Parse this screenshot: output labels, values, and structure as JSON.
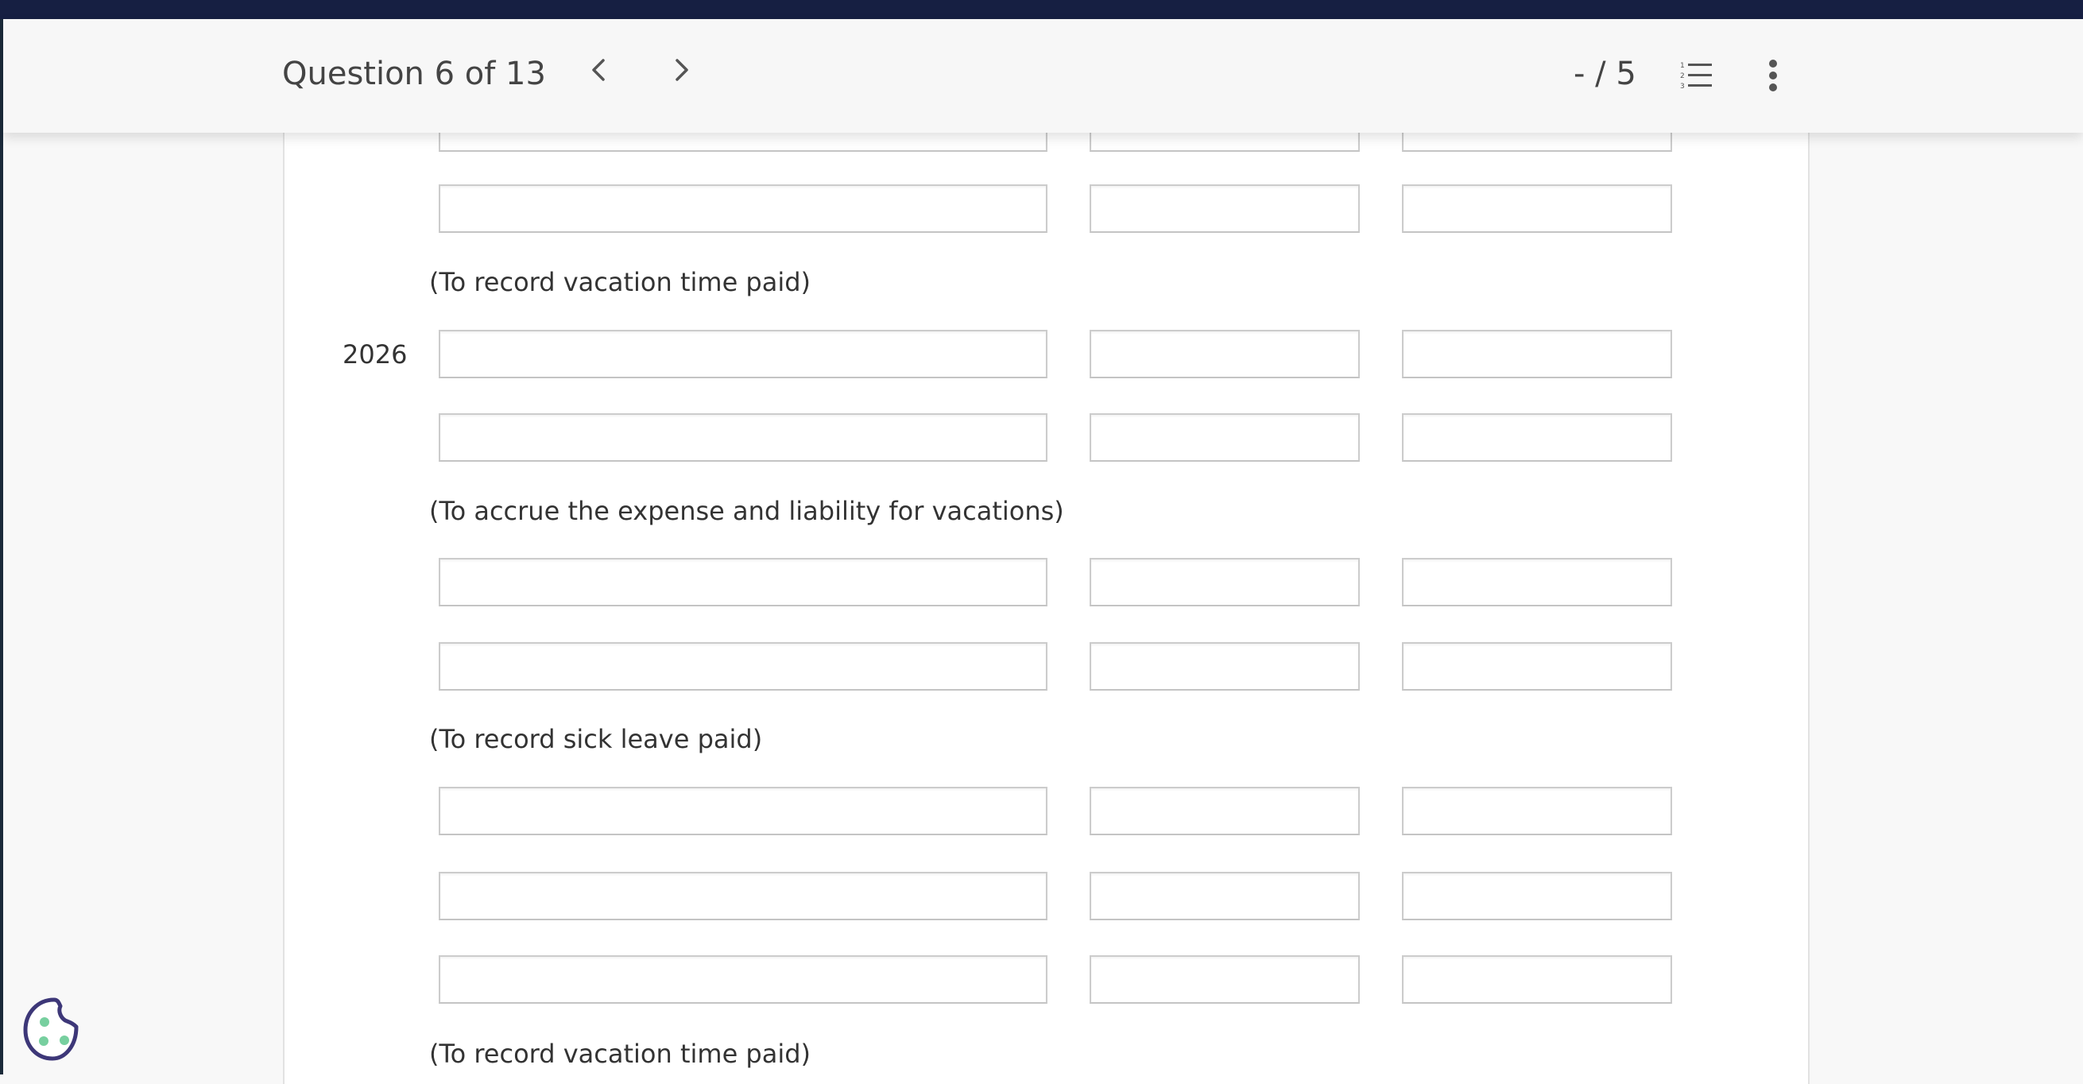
{
  "header": {
    "question_label": "Question 6 of 13",
    "prev_icon": "chevron-left-icon",
    "next_icon": "chevron-right-icon",
    "score": "- / 5",
    "list_icon": "numbered-list-icon",
    "menu_icon": "more-vertical-icon"
  },
  "form": {
    "year_label": "2026",
    "captions": [
      "(To record vacation time paid)",
      "(To accrue the expense and liability for vacations)",
      "(To record sick leave paid)",
      "(To record vacation time paid)"
    ]
  },
  "cookie": {
    "icon": "cookie-icon",
    "colors": {
      "outline": "#3d3778",
      "dots": "#77cf9f"
    }
  }
}
